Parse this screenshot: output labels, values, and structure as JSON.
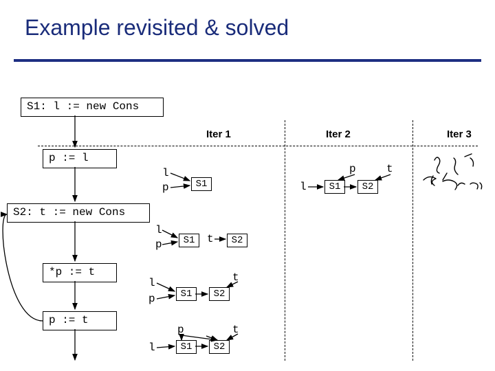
{
  "title": "Example revisited & solved",
  "iters": [
    "Iter 1",
    "Iter 2",
    "Iter 3"
  ],
  "cfg": {
    "s1": "S1: l := new Cons",
    "s2": "S2: t := new Cons",
    "p_l": "p := l",
    "sp_t": "*p := t",
    "p_t": "p := t"
  },
  "lbl": {
    "l": "l",
    "p": "p",
    "t": "t",
    "S1": "S1",
    "S2": "S2"
  }
}
